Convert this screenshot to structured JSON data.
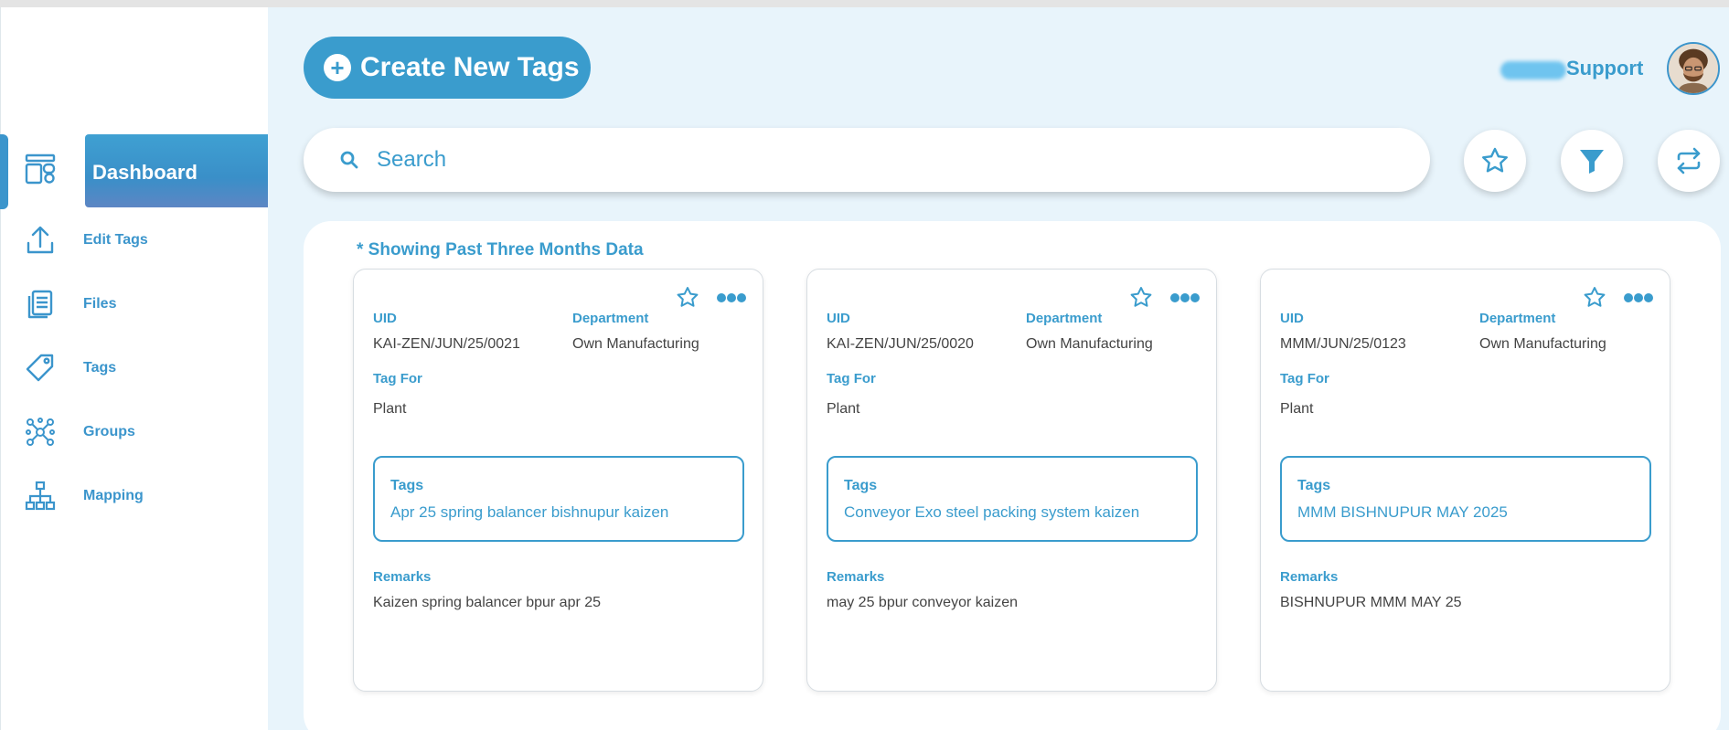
{
  "header": {
    "create_button_label": "Create New Tags",
    "user_label": "Support"
  },
  "sidebar": {
    "items": [
      {
        "label": "Dashboard",
        "icon": "dashboard-icon",
        "active": true
      },
      {
        "label": "Edit Tags",
        "icon": "upload-icon"
      },
      {
        "label": "Files",
        "icon": "files-icon"
      },
      {
        "label": "Tags",
        "icon": "tag-icon"
      },
      {
        "label": "Groups",
        "icon": "groups-icon"
      },
      {
        "label": "Mapping",
        "icon": "mapping-icon"
      }
    ]
  },
  "search": {
    "placeholder": "Search"
  },
  "toolbar": {
    "favorites_icon": "star-icon",
    "filter_icon": "filter-icon",
    "refresh_icon": "sync-icon"
  },
  "notice": "* Showing Past Three Months Data",
  "labels": {
    "uid": "UID",
    "department": "Department",
    "tag_for": "Tag For",
    "tags": "Tags",
    "remarks": "Remarks"
  },
  "cards": [
    {
      "uid": "KAI-ZEN/JUN/25/0021",
      "department": "Own Manufacturing",
      "tag_for": "Plant",
      "tags": "Apr 25 spring balancer bishnupur kaizen",
      "remarks": "Kaizen spring balancer bpur apr 25"
    },
    {
      "uid": "KAI-ZEN/JUN/25/0020",
      "department": "Own Manufacturing",
      "tag_for": "Plant",
      "tags": "Conveyor Exo steel packing system kaizen",
      "remarks": "may 25 bpur conveyor kaizen"
    },
    {
      "uid": "MMM/JUN/25/0123",
      "department": "Own Manufacturing",
      "tag_for": "Plant",
      "tags": "MMM BISHNUPUR MAY 2025",
      "remarks": "BISHNUPUR MMM MAY 25"
    }
  ],
  "colors": {
    "accent": "#3a9ccd",
    "background": "#e8f4fb"
  }
}
